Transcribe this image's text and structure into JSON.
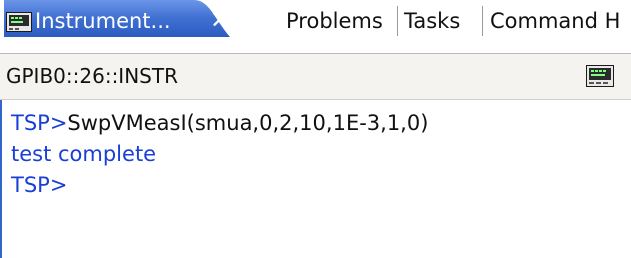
{
  "tabs": {
    "active": {
      "label": "Instrument...",
      "close_glyph": "✕",
      "icon": "instrument-monitor-icon"
    },
    "items": [
      {
        "label": "Problems"
      },
      {
        "label": "Tasks"
      },
      {
        "label": "Command H"
      }
    ]
  },
  "address": {
    "resource": "GPIB0::26::INSTR",
    "icon": "instrument-monitor-icon"
  },
  "console": {
    "line1": {
      "prompt": "TSP>",
      "command": "SwpVMeasI(smua,0,2,10,1E-3,1,0)"
    },
    "line2": {
      "text": "test complete"
    },
    "line3": {
      "prompt": "TSP>"
    }
  },
  "colors": {
    "tab_active_bg": "#3e6fd1",
    "prompt_blue": "#1a3fd6",
    "address_bg": "#f4f3ef"
  }
}
